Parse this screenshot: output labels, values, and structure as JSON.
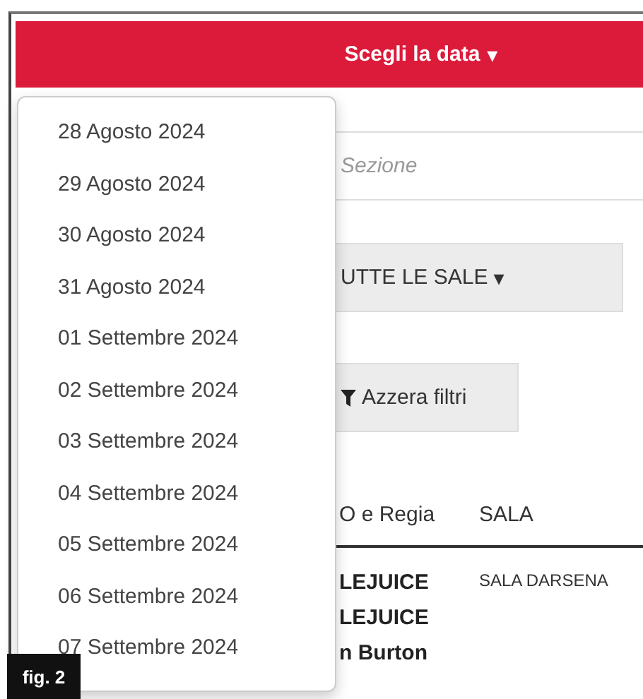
{
  "header": {
    "title": "Scegli la data",
    "caret": "▾"
  },
  "search": {
    "placeholder": "Sezione"
  },
  "room_filter": {
    "label": "UTTE LE SALE",
    "caret": "▾"
  },
  "reset_button": {
    "label": "Azzera filtri"
  },
  "table": {
    "columns": [
      "O e Regia",
      "SALA"
    ],
    "rows": [
      {
        "title_lines": [
          "LEJUICE",
          "LEJUICE",
          "n Burton"
        ],
        "room": "SALA DARSENA"
      }
    ]
  },
  "date_menu": {
    "items": [
      "28 Agosto 2024",
      "29 Agosto 2024",
      "30 Agosto 2024",
      "31 Agosto 2024",
      "01 Settembre 2024",
      "02 Settembre 2024",
      "03 Settembre 2024",
      "04 Settembre 2024",
      "05 Settembre 2024",
      "06 Settembre 2024",
      "07 Settembre 2024"
    ]
  },
  "figure_label": "fig. 2"
}
